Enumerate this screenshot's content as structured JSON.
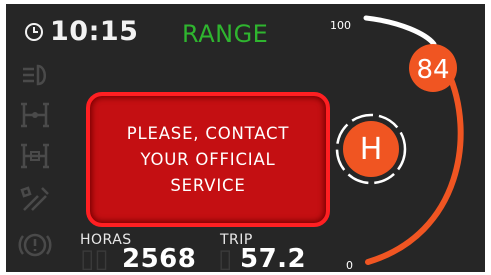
{
  "status_bar": {
    "time": "10:15",
    "drive_mode": "RANGE"
  },
  "alert": {
    "lines": [
      "PLEASE, CONTACT",
      "YOUR OFFICIAL",
      "SERVICE"
    ]
  },
  "gauge": {
    "max_label": "100",
    "min_label": "0",
    "value": "84",
    "level": 84,
    "indicator_letter": "H",
    "accent_color": "#f05522",
    "track_color": "#ffffff"
  },
  "odometers": {
    "hours_label": "HORAS",
    "hours_value": "2568",
    "trip_label": "TRIP",
    "trip_value": "57.2"
  },
  "telltales": [
    "headlight-icon",
    "axle-lock-icon",
    "diff-lock-icon",
    "service-wrench-icon",
    "brake-warning-icon"
  ]
}
